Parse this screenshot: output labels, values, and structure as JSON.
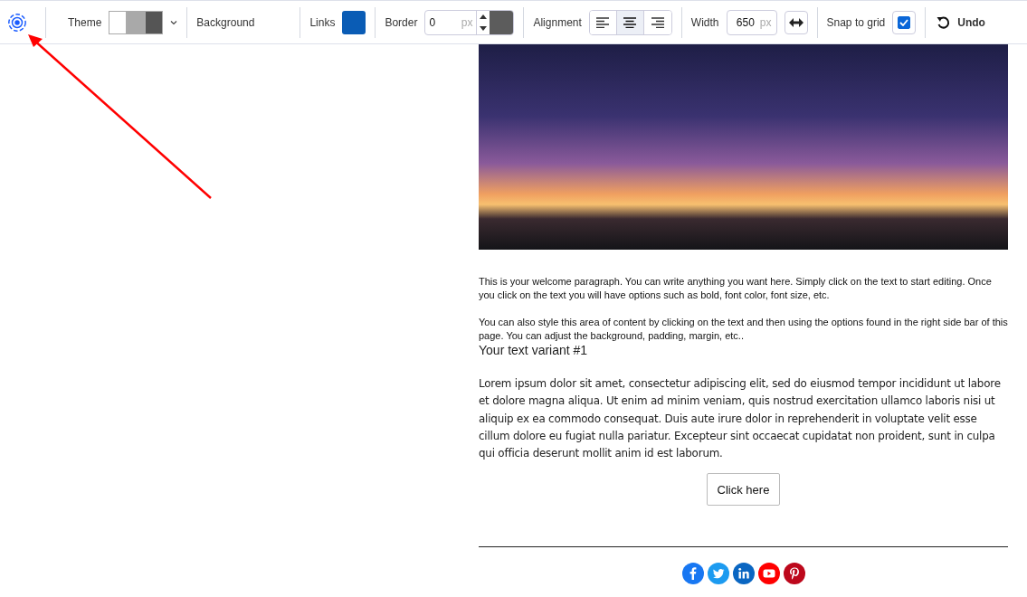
{
  "toolbar": {
    "theme": {
      "label": "Theme",
      "swatches": [
        {
          "color": "#ffffff"
        },
        {
          "color": "#a9a9a9"
        },
        {
          "color": "#555555"
        }
      ]
    },
    "background": {
      "label": "Background"
    },
    "links": {
      "label": "Links",
      "color": "#0a5cb5"
    },
    "border": {
      "label": "Border",
      "value": "0",
      "unit": "px",
      "color": "#5c5c5c"
    },
    "alignment": {
      "label": "Alignment",
      "options": [
        {
          "kind": "left",
          "selected": false
        },
        {
          "kind": "center",
          "selected": true
        },
        {
          "kind": "right",
          "selected": false
        }
      ]
    },
    "width": {
      "label": "Width",
      "value": "650",
      "unit": "px"
    },
    "snap": {
      "label": "Snap to grid",
      "checked": true
    },
    "undo": {
      "label": "Undo"
    }
  },
  "content": {
    "paragraphs": [
      "This is your welcome paragraph. You can write anything you want here. Simply click on the text to start editing. Once you click on the text you will have options such as bold, font color, font size, etc.",
      "You can also style this area of content by clicking on the text and then using the options found in the right side bar of this page. You can adjust the background, padding, margin, etc.."
    ],
    "variant": "Your text variant #1",
    "lorem": "Lorem ipsum dolor sit amet, consectetur adipiscing elit, sed do eiusmod tempor incididunt ut labore et dolore magna aliqua. Ut enim ad minim veniam, quis nostrud exercitation ullamco laboris nisi ut aliquip ex ea commodo consequat. Duis aute irure dolor in reprehenderit in voluptate velit esse cillum dolore eu fugiat nulla pariatur. Excepteur sint occaecat cupidatat non proident, sunt in culpa qui officia deserunt mollit anim id est laborum.",
    "button": "Click here",
    "social": [
      {
        "kind": "f",
        "color": "#1877f2"
      },
      {
        "kind": "bird",
        "color": "#1d9bf0"
      },
      {
        "kind": "in",
        "color": "#0a66c2"
      },
      {
        "kind": "play",
        "color": "#ff0000"
      },
      {
        "kind": "p",
        "color": "#bd081c"
      }
    ]
  }
}
